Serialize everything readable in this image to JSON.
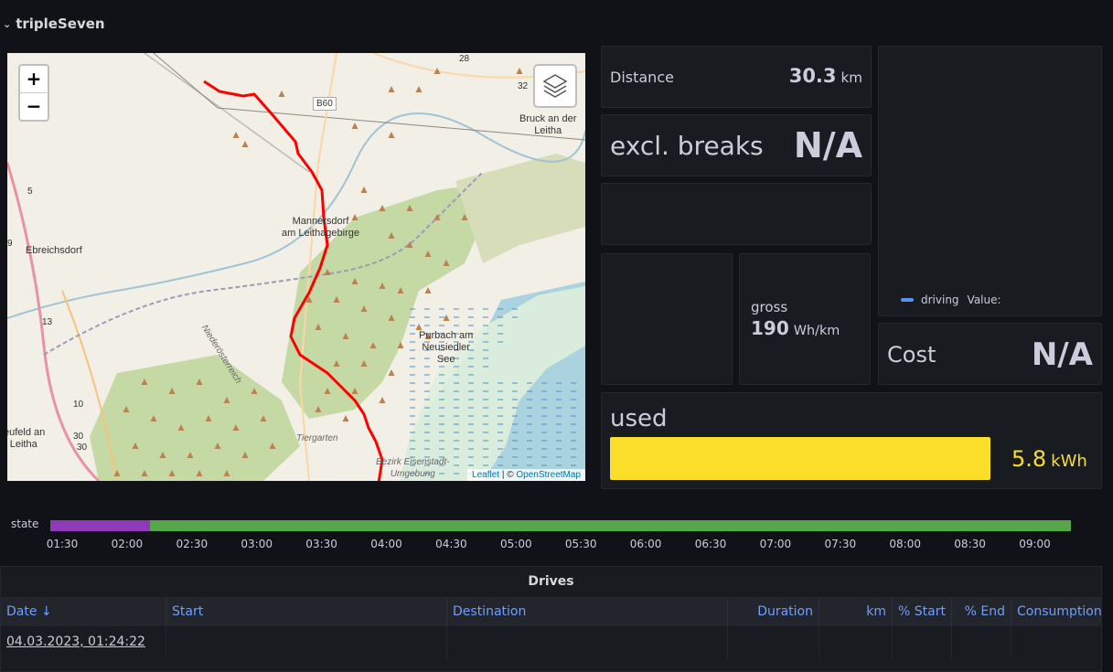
{
  "row": {
    "title": "tripleSeven"
  },
  "map": {
    "zoom_in": "+",
    "zoom_out": "−",
    "attribution_leaflet": "Leaflet",
    "attribution_sep": " | © ",
    "attribution_osm": "OpenStreetMap",
    "places": {
      "bruck": "Bruck an der\nLeitha",
      "mannersdorf": "Mannersdorf\nam Leithagebirge",
      "ebreichsdorf": "Ebreichsdorf",
      "purbach": "Purbach am\nNeusiedler\nSee",
      "seibersdorf": "eufeld an\nr Leitha",
      "tiergarten": "Tiergarten",
      "bezirk": "Bezirk Eisenstadt-\nUmgebung",
      "niederoesterreich": "Niederösterreich",
      "b60": "B60",
      "n28": "28",
      "n32": "32",
      "n5": "5",
      "n9": "9",
      "n13": "13",
      "n10": "10",
      "n30a": "30",
      "n30b": "30"
    }
  },
  "stats": {
    "distance": {
      "title": "Distance",
      "value": "30.3",
      "unit": "km"
    },
    "excl_breaks": {
      "title": "excl. breaks",
      "value": "N/A"
    },
    "gross": {
      "title": "gross",
      "value": "190",
      "unit": "Wh/km"
    },
    "cost": {
      "title": "Cost",
      "value": "N/A"
    },
    "used": {
      "title": "used",
      "value": "5.8",
      "unit": "kWh",
      "fill_fraction": 1.0,
      "color": "#fade2a"
    }
  },
  "legend": {
    "series": "driving",
    "value_label": "Value:",
    "color": "#5794f2"
  },
  "state_timeline": {
    "label": "state",
    "ticks": [
      "01:30",
      "02:00",
      "02:30",
      "03:00",
      "03:30",
      "04:00",
      "04:30",
      "05:00",
      "05:30",
      "06:00",
      "06:30",
      "07:00",
      "07:30",
      "08:00",
      "08:30",
      "09:00"
    ],
    "segments": [
      {
        "color": "#8f3bb8"
      },
      {
        "color": "#56a64b"
      }
    ]
  },
  "drives": {
    "title": "Drives",
    "columns": [
      "Date ↓",
      "Start",
      "Destination",
      "Duration",
      "km",
      "% Start",
      "% End",
      "Consumption"
    ],
    "rows": [
      {
        "date": "04.03.2023, 01:24:22",
        "start": "",
        "destination": "",
        "duration": "",
        "km": "",
        "pct_start": "",
        "pct_end": "",
        "consumption": ""
      }
    ]
  }
}
